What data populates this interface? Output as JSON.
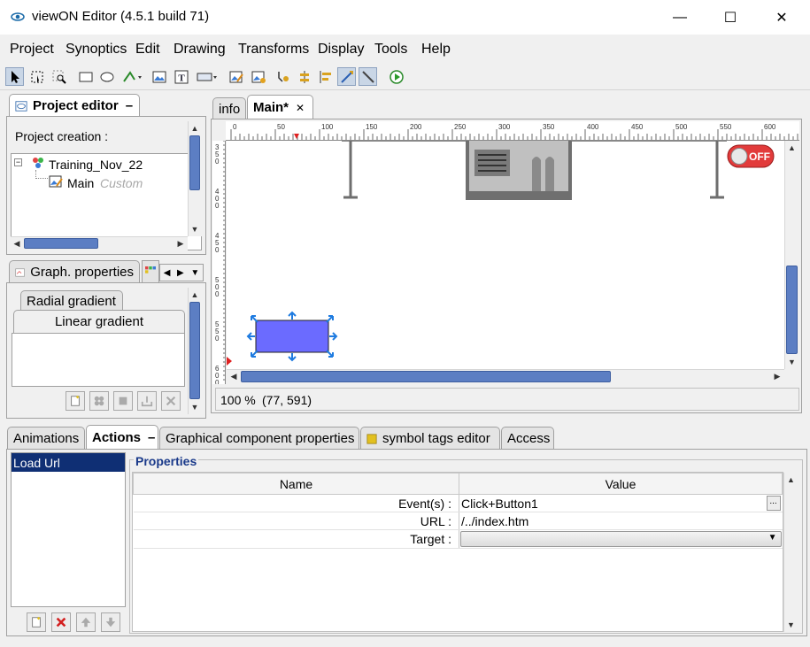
{
  "window": {
    "title": "viewON Editor (4.5.1 build 71)",
    "minimize": "—",
    "maximize": "☐",
    "close": "✕"
  },
  "menu": [
    "Project",
    "Synoptics",
    "Edit",
    "Drawing",
    "Transforms",
    "Display",
    "Tools",
    "Help"
  ],
  "project_editor": {
    "tab_label": "Project editor",
    "header": "Project creation :",
    "tree": {
      "root": "Training_Nov_22",
      "child_name": "Main",
      "child_type": "Custom"
    }
  },
  "graph_properties": {
    "tab_label": "Graph. properties",
    "subtab_radial": "Radial gradient",
    "subtab_linear": "Linear gradient"
  },
  "editor_tabs": {
    "info": "info",
    "main": "Main*",
    "close": "✕"
  },
  "ruler": {
    "h_labels": [
      "0",
      "50",
      "100",
      "150",
      "200",
      "250",
      "300",
      "350",
      "400",
      "450",
      "500",
      "550",
      "600"
    ],
    "v_labels": [
      "350",
      "400",
      "450",
      "500",
      "550",
      "600"
    ]
  },
  "canvas": {
    "toggle_label": "OFF"
  },
  "status": {
    "zoom": "100 %",
    "coords": "(77, 591)"
  },
  "bottom_tabs": [
    "Animations",
    "Actions",
    "Graphical component properties",
    "symbol tags editor",
    "Access"
  ],
  "actions": {
    "list": [
      "Load Url"
    ],
    "properties_title": "Properties",
    "col_name": "Name",
    "col_value": "Value",
    "rows": [
      {
        "name": "Event(s) :",
        "value": "Click+Button1"
      },
      {
        "name": "URL :",
        "value": "/../index.htm"
      },
      {
        "name": "Target :",
        "value": ""
      }
    ],
    "ellipsis": "..."
  },
  "colors": {
    "scroll_thumb": "#5c7ec3",
    "selected_item": "#0f2f74",
    "shape_fill": "#6b6bff",
    "toggle_red": "#e23b3b"
  }
}
